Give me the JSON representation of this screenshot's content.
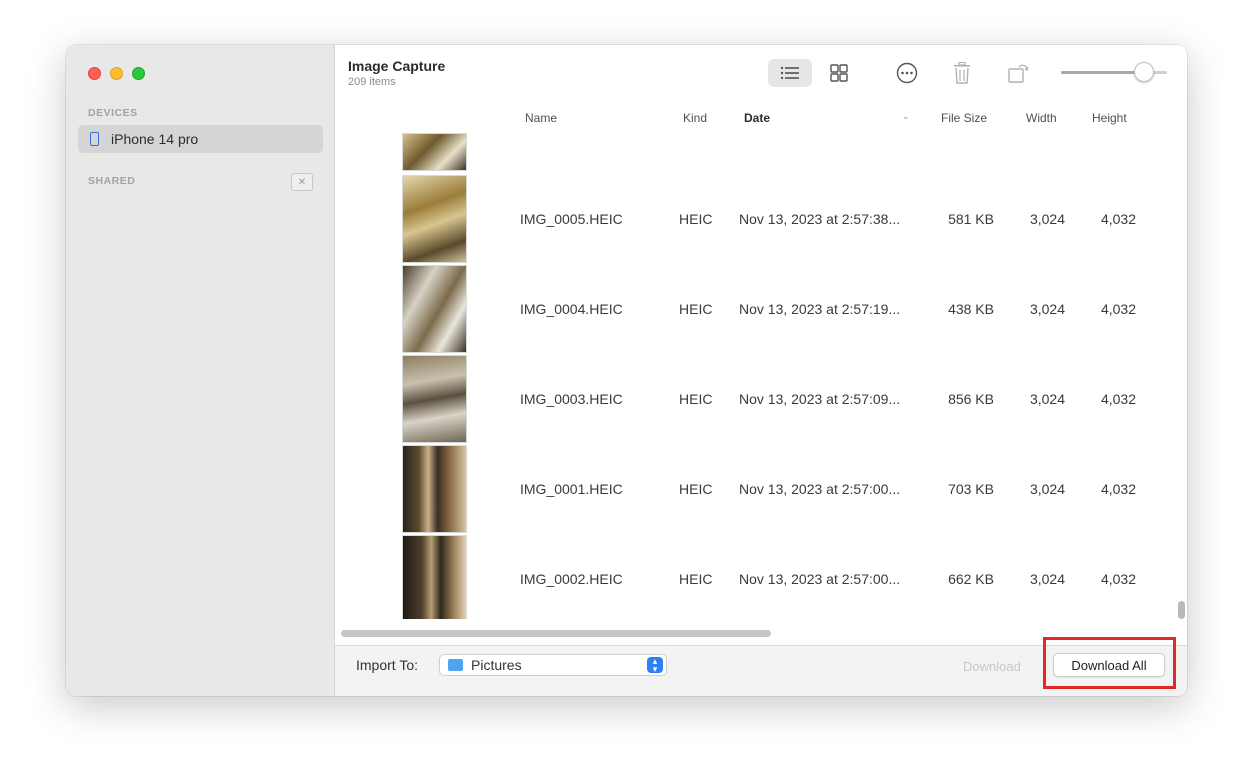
{
  "sidebar": {
    "devices_label": "DEVICES",
    "device_name": "iPhone 14 pro",
    "shared_label": "SHARED"
  },
  "header": {
    "title": "Image Capture",
    "subtitle": "209 items"
  },
  "toolbar": {
    "zoom_level": 0.78,
    "icons": [
      "list-view-icon",
      "grid-view-icon",
      "more-icon",
      "trash-icon",
      "rotate-icon"
    ]
  },
  "columns": {
    "name": "Name",
    "kind": "Kind",
    "date": "Date",
    "file_size": "File Size",
    "width": "Width",
    "height": "Height"
  },
  "rows": [
    {
      "name": "IMG_0005.HEIC",
      "kind": "HEIC",
      "date": "Nov 13, 2023 at 2:57:38...",
      "size": "581 KB",
      "width": "3,024",
      "height": "4,032"
    },
    {
      "name": "IMG_0004.HEIC",
      "kind": "HEIC",
      "date": "Nov 13, 2023 at 2:57:19...",
      "size": "438 KB",
      "width": "3,024",
      "height": "4,032"
    },
    {
      "name": "IMG_0003.HEIC",
      "kind": "HEIC",
      "date": "Nov 13, 2023 at 2:57:09...",
      "size": "856 KB",
      "width": "3,024",
      "height": "4,032"
    },
    {
      "name": "IMG_0001.HEIC",
      "kind": "HEIC",
      "date": "Nov 13, 2023 at 2:57:00...",
      "size": "703 KB",
      "width": "3,024",
      "height": "4,032"
    },
    {
      "name": "IMG_0002.HEIC",
      "kind": "HEIC",
      "date": "Nov 13, 2023 at 2:57:00...",
      "size": "662 KB",
      "width": "3,024",
      "height": "4,032"
    }
  ],
  "footer": {
    "import_label": "Import To:",
    "import_value": "Pictures",
    "download_label": "Download",
    "download_all_label": "Download All"
  },
  "colors": {
    "accent": "#2f7ff5",
    "highlight": "#e5272d",
    "folder": "#4ea4ee"
  }
}
